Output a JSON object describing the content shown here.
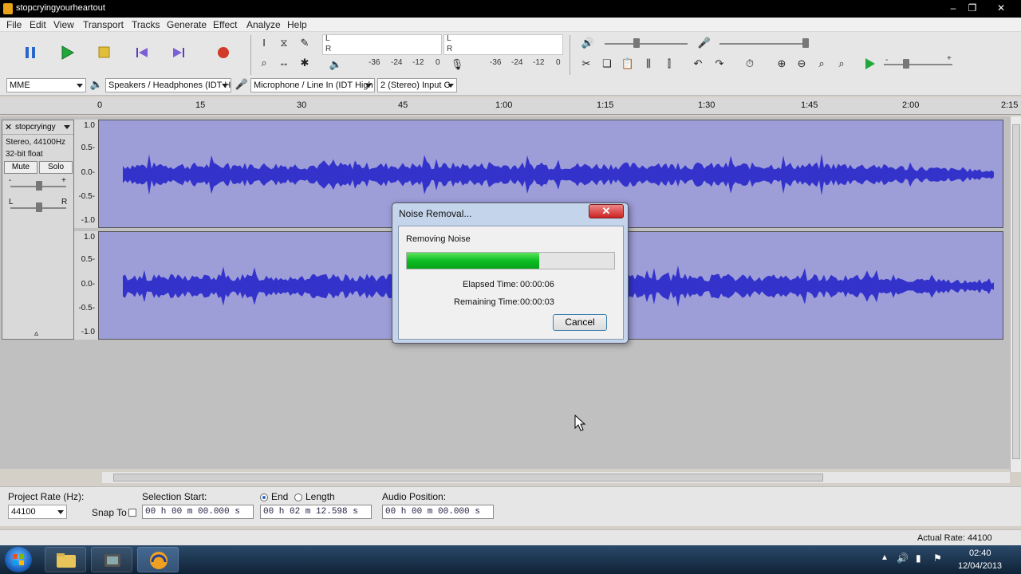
{
  "window": {
    "title": "stopcryingyourheartout",
    "controls": [
      "–",
      "❐",
      "✕"
    ]
  },
  "menu": [
    "File",
    "Edit",
    "View",
    "Transport",
    "Tracks",
    "Generate",
    "Effect",
    "Analyze",
    "Help"
  ],
  "meters": {
    "left_channel": "L",
    "right_channel": "R",
    "playback_scale": [
      "-36",
      "-24",
      "-12",
      "0"
    ],
    "record_scale": [
      "-36",
      "-24",
      "-12",
      "0"
    ],
    "minus": "-",
    "plus": "+"
  },
  "devices": {
    "host": "MME",
    "output": "Speakers / Headphones (IDT H",
    "input": "Microphone / Line In (IDT High",
    "channels": "2 (Stereo) Input C"
  },
  "timeline": {
    "ticks": [
      "0",
      "15",
      "30",
      "45",
      "1:00",
      "1:15",
      "1:30",
      "1:45",
      "2:00",
      "2:15"
    ]
  },
  "track": {
    "name": "stopcryingy",
    "format": "Stereo, 44100Hz",
    "bit_depth": "32-bit float",
    "mute_label": "Mute",
    "solo_label": "Solo",
    "gain_minus": "-",
    "gain_plus": "+",
    "pan_left": "L",
    "pan_right": "R",
    "scale_labels": [
      "1.0",
      "0.5-",
      "0.0-",
      "-0.5-",
      "-1.0"
    ]
  },
  "dialog": {
    "title": "Noise Removal...",
    "status": "Removing Noise",
    "progress": 0.64,
    "elapsed_label": "Elapsed Time:",
    "elapsed_value": "00:00:06",
    "remaining_label": "Remaining Time:",
    "remaining_value": "00:00:03",
    "cancel_label": "Cancel"
  },
  "selection_bar": {
    "project_rate_label": "Project Rate (Hz):",
    "project_rate_value": "44100",
    "snap_to_label": "Snap To",
    "selection_start_label": "Selection Start:",
    "selection_start_value": "00 h 00 m 00.000 s",
    "end_label": "End",
    "length_label": "Length",
    "end_value": "00 h 02 m 12.598 s",
    "audio_position_label": "Audio Position:",
    "audio_position_value": "00 h 00 m 00.000 s"
  },
  "status": {
    "actual_rate": "Actual Rate: 44100"
  },
  "taskbar": {
    "time": "02:40",
    "date": "12/04/2013"
  },
  "colors": {
    "waveform": "#3333cc",
    "track_bg": "#9d9dd8",
    "progress": "#0cbd22"
  }
}
